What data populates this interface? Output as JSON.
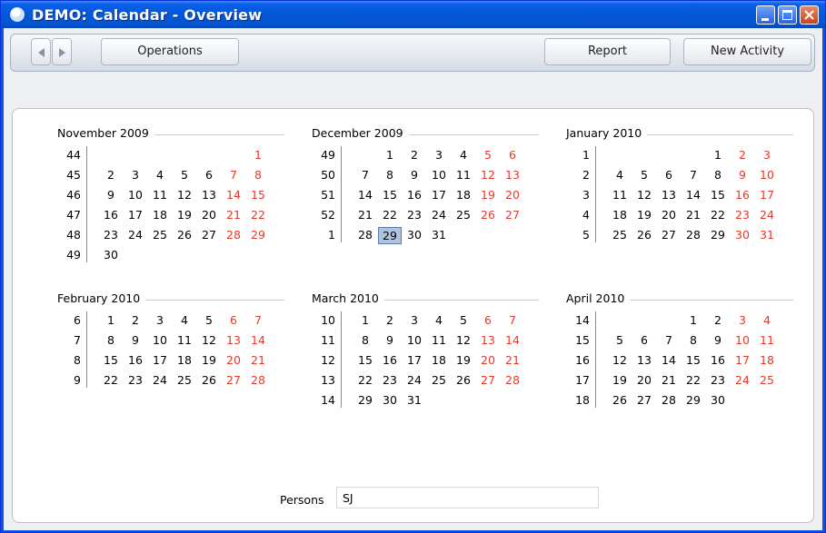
{
  "window": {
    "title": "DEMO: Calendar - Overview",
    "icon": "app-globe-icon",
    "controls": [
      "minimize-icon",
      "maximize-icon",
      "close-icon"
    ]
  },
  "toolbar": {
    "prev_icon": "left-arrow-icon",
    "next_icon": "right-arrow-icon",
    "operations_label": "Operations",
    "report_label": "Report",
    "new_activity_label": "New Activity"
  },
  "colors": {
    "weekend": "#E53A2A",
    "selected_day_bg": "#AFC3DE",
    "title_bar": "#0554D0"
  },
  "selected_date": "29 December 2009",
  "months": [
    {
      "title": "November 2009",
      "weeks": [
        {
          "w": "44",
          "days": [
            "",
            "",
            "",
            "",
            "",
            "",
            "1"
          ]
        },
        {
          "w": "45",
          "days": [
            "2",
            "3",
            "4",
            "5",
            "6",
            "7",
            "8"
          ]
        },
        {
          "w": "46",
          "days": [
            "9",
            "10",
            "11",
            "12",
            "13",
            "14",
            "15"
          ]
        },
        {
          "w": "47",
          "days": [
            "16",
            "17",
            "18",
            "19",
            "20",
            "21",
            "22"
          ]
        },
        {
          "w": "48",
          "days": [
            "23",
            "24",
            "25",
            "26",
            "27",
            "28",
            "29"
          ]
        },
        {
          "w": "49",
          "days": [
            "30",
            "",
            "",
            "",
            "",
            "",
            ""
          ]
        }
      ]
    },
    {
      "title": "December 2009",
      "weeks": [
        {
          "w": "49",
          "days": [
            "",
            "1",
            "2",
            "3",
            "4",
            "5",
            "6"
          ]
        },
        {
          "w": "50",
          "days": [
            "7",
            "8",
            "9",
            "10",
            "11",
            "12",
            "13"
          ]
        },
        {
          "w": "51",
          "days": [
            "14",
            "15",
            "16",
            "17",
            "18",
            "19",
            "20"
          ]
        },
        {
          "w": "52",
          "days": [
            "21",
            "22",
            "23",
            "24",
            "25",
            "26",
            "27"
          ]
        },
        {
          "w": "1",
          "days": [
            "28",
            "29",
            "30",
            "31",
            "",
            "",
            ""
          ]
        }
      ]
    },
    {
      "title": "January 2010",
      "weeks": [
        {
          "w": "1",
          "days": [
            "",
            "",
            "",
            "",
            "1",
            "2",
            "3"
          ]
        },
        {
          "w": "2",
          "days": [
            "4",
            "5",
            "6",
            "7",
            "8",
            "9",
            "10"
          ]
        },
        {
          "w": "3",
          "days": [
            "11",
            "12",
            "13",
            "14",
            "15",
            "16",
            "17"
          ]
        },
        {
          "w": "4",
          "days": [
            "18",
            "19",
            "20",
            "21",
            "22",
            "23",
            "24"
          ]
        },
        {
          "w": "5",
          "days": [
            "25",
            "26",
            "27",
            "28",
            "29",
            "30",
            "31"
          ]
        }
      ]
    },
    {
      "title": "February 2010",
      "weeks": [
        {
          "w": "6",
          "days": [
            "1",
            "2",
            "3",
            "4",
            "5",
            "6",
            "7"
          ]
        },
        {
          "w": "7",
          "days": [
            "8",
            "9",
            "10",
            "11",
            "12",
            "13",
            "14"
          ]
        },
        {
          "w": "8",
          "days": [
            "15",
            "16",
            "17",
            "18",
            "19",
            "20",
            "21"
          ]
        },
        {
          "w": "9",
          "days": [
            "22",
            "23",
            "24",
            "25",
            "26",
            "27",
            "28"
          ]
        }
      ]
    },
    {
      "title": "March 2010",
      "weeks": [
        {
          "w": "10",
          "days": [
            "1",
            "2",
            "3",
            "4",
            "5",
            "6",
            "7"
          ]
        },
        {
          "w": "11",
          "days": [
            "8",
            "9",
            "10",
            "11",
            "12",
            "13",
            "14"
          ]
        },
        {
          "w": "12",
          "days": [
            "15",
            "16",
            "17",
            "18",
            "19",
            "20",
            "21"
          ]
        },
        {
          "w": "13",
          "days": [
            "22",
            "23",
            "24",
            "25",
            "26",
            "27",
            "28"
          ]
        },
        {
          "w": "14",
          "days": [
            "29",
            "30",
            "31",
            "",
            "",
            "",
            ""
          ]
        }
      ]
    },
    {
      "title": "April 2010",
      "weeks": [
        {
          "w": "14",
          "days": [
            "",
            "",
            "",
            "1",
            "2",
            "3",
            "4"
          ]
        },
        {
          "w": "15",
          "days": [
            "5",
            "6",
            "7",
            "8",
            "9",
            "10",
            "11"
          ]
        },
        {
          "w": "16",
          "days": [
            "12",
            "13",
            "14",
            "15",
            "16",
            "17",
            "18"
          ]
        },
        {
          "w": "17",
          "days": [
            "19",
            "20",
            "21",
            "22",
            "23",
            "24",
            "25"
          ]
        },
        {
          "w": "18",
          "days": [
            "26",
            "27",
            "28",
            "29",
            "30",
            "",
            ""
          ]
        }
      ]
    }
  ],
  "persons": {
    "label": "Persons",
    "value": "SJ"
  }
}
